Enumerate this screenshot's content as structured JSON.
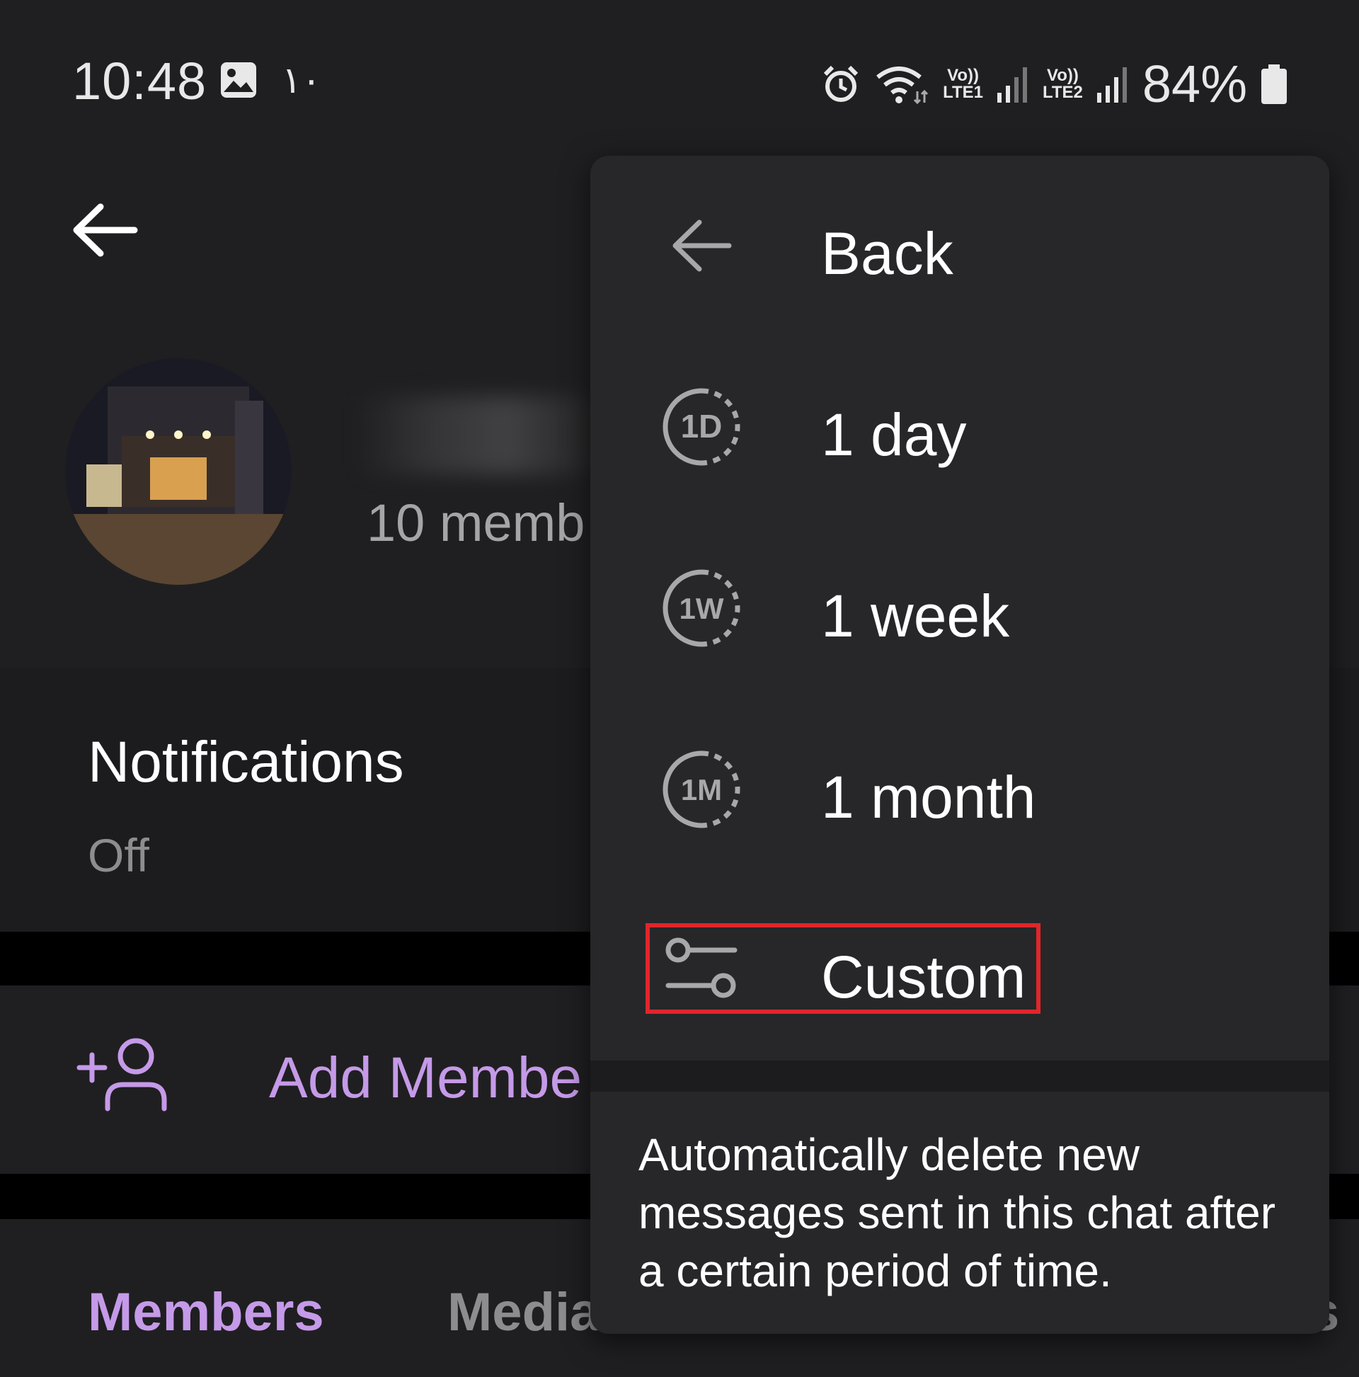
{
  "status_bar": {
    "time": "10:48",
    "extra_indicator": "١٠",
    "sim1_label_top": "Vo))",
    "sim1_label_bottom": "LTE1",
    "sim2_label_top": "Vo))",
    "sim2_label_bottom": "LTE2",
    "battery": "84%"
  },
  "profile": {
    "members_count": "10 memb"
  },
  "notifications": {
    "title": "Notifications",
    "status": "Off"
  },
  "add_member": {
    "label": "Add Membe"
  },
  "tabs": [
    {
      "label": "Members"
    },
    {
      "label": "Media"
    },
    {
      "label": "s"
    }
  ],
  "auto_delete_menu": {
    "items": [
      {
        "label": "Back",
        "icon": "back-arrow-icon"
      },
      {
        "label": "1 day",
        "icon": "timer-1d-icon",
        "icon_text": "1D"
      },
      {
        "label": "1 week",
        "icon": "timer-1w-icon",
        "icon_text": "1W"
      },
      {
        "label": "1 month",
        "icon": "timer-1m-icon",
        "icon_text": "1M"
      },
      {
        "label": "Custom",
        "icon": "sliders-icon"
      }
    ],
    "description": "Automatically delete new messages sent in this chat after a certain period of time."
  },
  "colors": {
    "accent": "#c59ae8",
    "highlight_border": "#e0262b",
    "menu_bg": "#272729",
    "screen_bg": "#1c1c1e"
  }
}
